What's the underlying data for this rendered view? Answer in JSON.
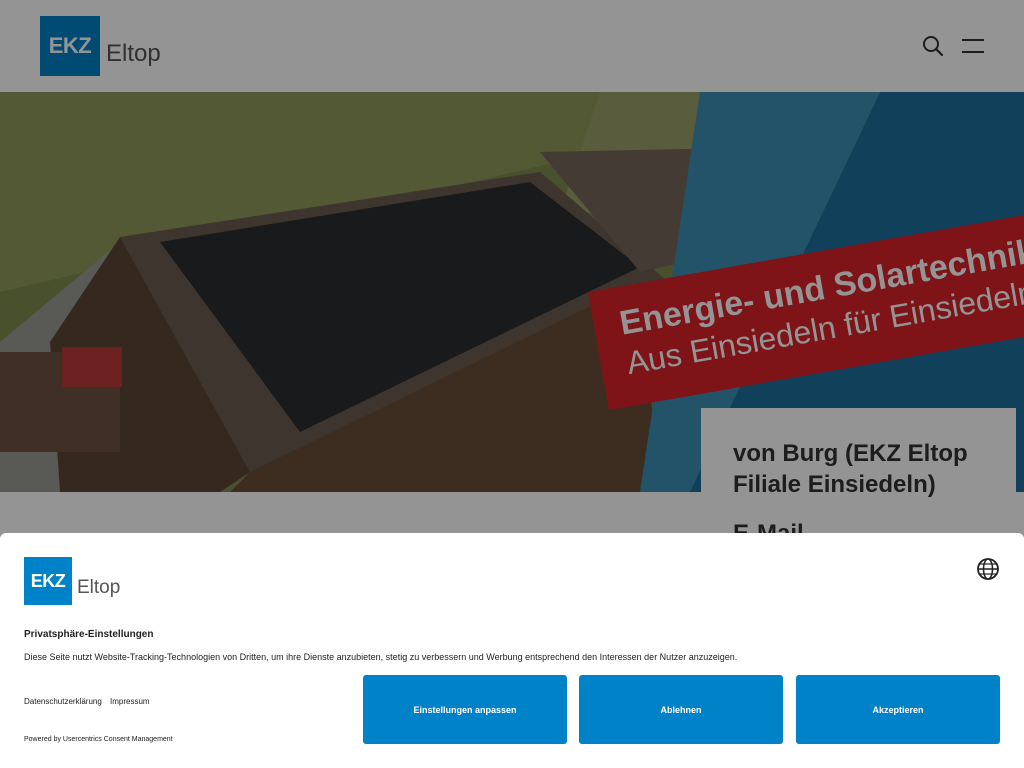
{
  "header": {
    "logo_mark": "EKZ",
    "logo_name": "Eltop",
    "search_icon": "search-icon",
    "menu_icon": "hamburger-menu-icon"
  },
  "hero": {
    "banner_line1": "Energie- und Solartechnik",
    "banner_line2": "Aus Einsiedeln für Einsiedeln"
  },
  "contact": {
    "name": "von Burg (EKZ Eltop Filiale Einsiedeln)",
    "email_label": "E-Mail"
  },
  "consent": {
    "logo_mark": "EKZ",
    "logo_name": "Eltop",
    "language_icon": "globe-icon",
    "title": "Privatsphäre-Einstellungen",
    "description": "Diese Seite nutzt Website-Tracking-Technologien von Dritten, um ihre Dienste anzubieten, stetig zu verbessern und Werbung entsprechend den Interessen der Nutzer anzuzeigen.",
    "links": [
      "Datenschutzerklärung",
      "Impressum"
    ],
    "powered_by": "Powered by Usercentrics Consent Management",
    "buttons": {
      "settings": "Einstellungen anpassen",
      "deny": "Ablehnen",
      "accept": "Akzeptieren"
    }
  },
  "colors": {
    "brand_blue": "#0082c8",
    "banner_red": "#d9222a"
  }
}
